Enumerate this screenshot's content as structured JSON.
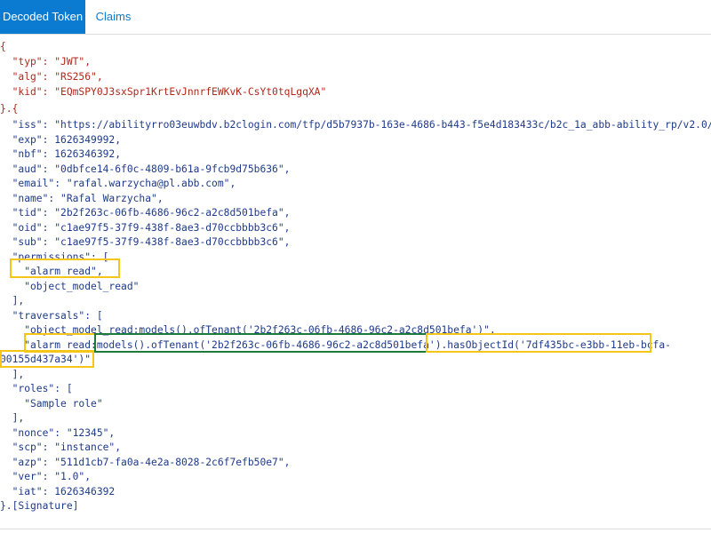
{
  "tabs": {
    "decoded": "Decoded Token",
    "claims": "Claims"
  },
  "header": {
    "open": "{",
    "typ": "  \"typ\": \"JWT\",",
    "alg": "  \"alg\": \"RS256\",",
    "kid": "  \"kid\": \"EQmSPY0J3sxSpr1KrtEvJnnrfEWKvK-CsYt0tqLgqXA\"",
    "close": "}.{"
  },
  "payload": {
    "iss": "  \"iss\": \"https://abilityrro03euwbdv.b2clogin.com/tfp/d5b7937b-163e-4686-b443-f5e4d183433c/b2c_1a_abb-ability_rp/v2.0/\",",
    "exp": "  \"exp\": 1626349992,",
    "nbf": "  \"nbf\": 1626346392,",
    "aud": "  \"aud\": \"0dbfce14-6f0c-4809-b61a-9fcb9d75b636\",",
    "email": "  \"email\": \"rafal.warzycha@pl.abb.com\",",
    "name": "  \"name\": \"Rafal Warzycha\",",
    "tid": "  \"tid\": \"2b2f263c-06fb-4686-96c2-a2c8d501befa\",",
    "oid": "  \"oid\": \"c1ae97f5-37f9-438f-8ae3-d70ccbbbb3c6\",",
    "sub": "  \"sub\": \"c1ae97f5-37f9-438f-8ae3-d70ccbbbb3c6\",",
    "permissions_open": "  \"permissions\": [",
    "perm_1": "    \"alarm_read\",",
    "perm_2": "    \"object_model_read\"",
    "permissions_close": "  ],",
    "traversals_open": "  \"traversals\": [",
    "trav_1": "    \"object_model_read:models().ofTenant('2b2f263c-06fb-4686-96c2-a2c8d501befa')\",",
    "trav_2": "    \"alarm_read:models().ofTenant('2b2f263c-06fb-4686-96c2-a2c8d501befa').hasObjectId('7df435bc-e3bb-11eb-bcfa-",
    "trav_2b": "00155d437a34')\"",
    "traversals_close": "  ],",
    "roles_open": "  \"roles\": [",
    "role_1": "    \"Sample role\"",
    "roles_close": "  ],",
    "nonce": "  \"nonce\": \"12345\",",
    "scp": "  \"scp\": \"instance\",",
    "azp": "  \"azp\": \"511d1cb7-fa0a-4e2a-8028-2c6f7efb50e7\",",
    "ver": "  \"ver\": \"1.0\",",
    "iat": "  \"iat\": 1626346392",
    "close": "}.[Signature]"
  },
  "colors": {
    "tab_active": "#0a7bd0",
    "header_text": "#b0281a",
    "payload_text": "#1e3a8a",
    "highlight_yellow": "#f5c518",
    "highlight_green": "#1c7a3a"
  }
}
